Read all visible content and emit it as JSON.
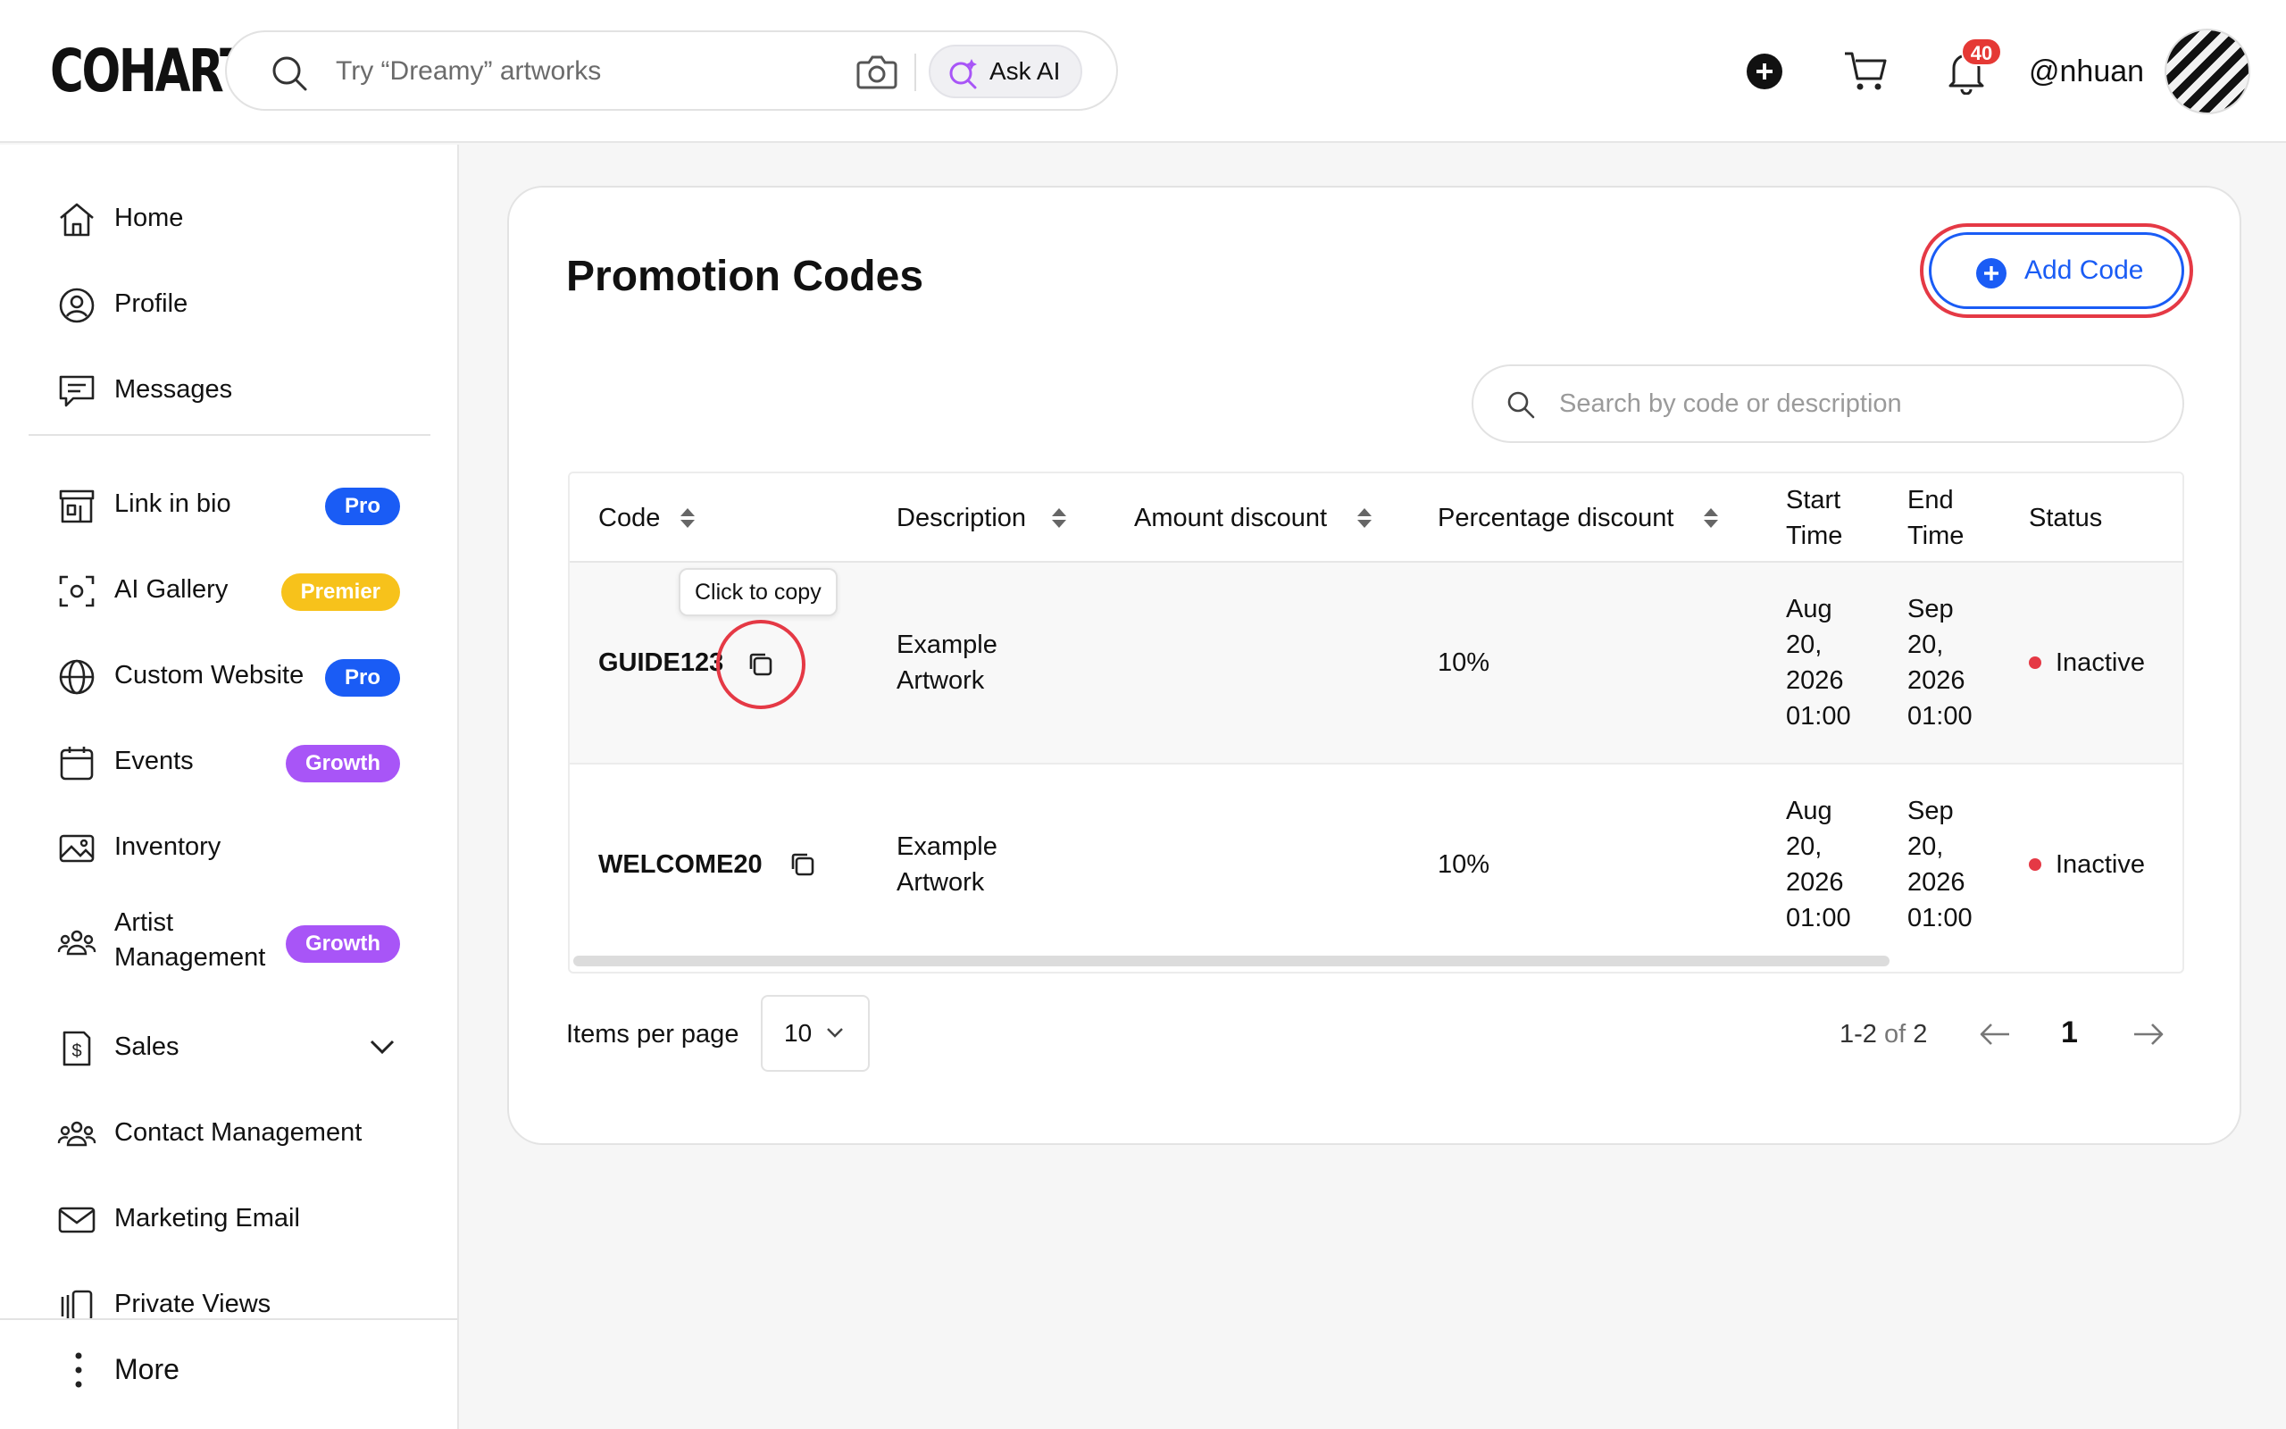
{
  "header": {
    "logo": "COHART",
    "search_placeholder": "Try “Dreamy” artworks",
    "ask_ai_label": "Ask AI",
    "notification_count": "40",
    "username": "@nhuan"
  },
  "sidebar": {
    "items": [
      {
        "label": "Home",
        "icon": "home-icon"
      },
      {
        "label": "Profile",
        "icon": "profile-icon"
      },
      {
        "label": "Messages",
        "icon": "messages-icon"
      },
      {
        "label": "Link in bio",
        "icon": "storefront-icon",
        "badge": "Pro"
      },
      {
        "label": "AI Gallery",
        "icon": "scan-icon",
        "badge": "Premier"
      },
      {
        "label": "Custom Website",
        "icon": "globe-icon",
        "badge": "Pro"
      },
      {
        "label": "Events",
        "icon": "calendar-icon",
        "badge": "Growth"
      },
      {
        "label": "Inventory",
        "icon": "image-icon"
      },
      {
        "label": "Artist\nManagement",
        "label_line1": "Artist",
        "label_line2": "Management",
        "icon": "people-icon",
        "badge": "Growth"
      },
      {
        "label": "Sales",
        "icon": "dollar-doc-icon"
      },
      {
        "label": "Contact Management",
        "icon": "contacts-icon"
      },
      {
        "label": "Marketing Email",
        "icon": "mail-icon"
      },
      {
        "label": "Private Views",
        "icon": "views-icon"
      }
    ],
    "more_label": "More"
  },
  "main": {
    "title": "Promotion Codes",
    "add_button_label": "Add Code",
    "search_placeholder": "Search by code or description",
    "columns": {
      "code": "Code",
      "description": "Description",
      "amount_discount": "Amount discount",
      "percentage_discount": "Percentage discount",
      "start_time_1": "Start",
      "start_time_2": "Time",
      "end_time_1": "End",
      "end_time_2": "Time",
      "status": "Status"
    },
    "rows": [
      {
        "code": "GUIDE123",
        "description_1": "Example",
        "description_2": "Artwork",
        "amount_discount": "",
        "percentage_discount": "10%",
        "start": [
          "Aug",
          "20,",
          "2026",
          "01:00"
        ],
        "end": [
          "Sep",
          "20,",
          "2026",
          "01:00"
        ],
        "status": "Inactive"
      },
      {
        "code": "WELCOME20",
        "description_1": "Example",
        "description_2": "Artwork",
        "amount_discount": "",
        "percentage_discount": "10%",
        "start": [
          "Aug",
          "20,",
          "2026",
          "01:00"
        ],
        "end": [
          "Sep",
          "20,",
          "2026",
          "01:00"
        ],
        "status": "Inactive"
      }
    ],
    "tooltip": "Click to copy",
    "pagination": {
      "items_per_page_label": "Items per page",
      "items_per_page_value": "10",
      "range": "1-2",
      "of_label": "of",
      "total": "2",
      "current_page": "1"
    }
  },
  "colors": {
    "accent": "#1a5cf5",
    "status_inactive": "#e53945",
    "premier": "#f7c21b",
    "growth": "#a855f7",
    "notification": "#e53935"
  }
}
